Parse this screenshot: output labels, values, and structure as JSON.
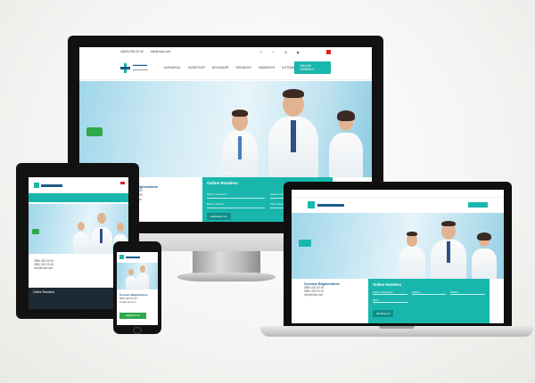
{
  "desktop": {
    "topbar": {
      "phone": "0(850) 000 00 00",
      "email": "info@mail.com"
    },
    "menu": [
      "KURUMSAL",
      "HİZMETLER",
      "BÖLÜMLER",
      "HEKİMLER",
      "HABERLER",
      "İLETİŞİM"
    ],
    "cta_label": "ONLINE RANDEVU",
    "info": {
      "title": "Ücretsiz Bilgilendirme",
      "lines": [
        "0850 000 00 00",
        "0850 000 00 00",
        "info@mail.com"
      ]
    },
    "form": {
      "title": "Online Randevu",
      "fields": [
        "Adınız Soyadınız",
        "Telefon Numaranız",
        "Bölüm Seçiniz",
        "Tarih Seçiniz"
      ],
      "button": "RANDEVU AL"
    }
  },
  "laptop": {
    "info_title": "Ücretsiz Bilgilendirme",
    "info_lines": [
      "0850 000 00 00",
      "0850 000 00 00",
      "info@mail.com"
    ],
    "form_title": "Online Randevu",
    "form_fields": [
      "Adınız Soyadınız",
      "Telefon",
      "Bölüm",
      "Tarih"
    ],
    "button": "Randevu Al"
  },
  "tablet": {
    "lines": [
      "0850 000 00 00",
      "0850 000 00 00",
      "info@mail.com"
    ],
    "footer": "Online Randevu"
  },
  "phone": {
    "info_title": "Ücretsiz Bilgilendirme",
    "lines": [
      "0850 000 00 00",
      "info@mail.com"
    ],
    "button": "RANDEVU AL"
  },
  "colors": {
    "accent": "#19b6ad",
    "brand": "#1a5a8a",
    "green": "#2ea84a"
  }
}
